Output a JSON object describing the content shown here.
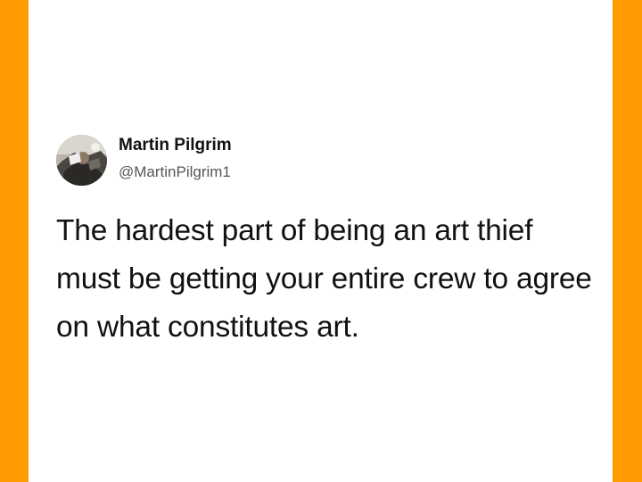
{
  "colors": {
    "background": "#FF9B00",
    "card": "#FFFFFF",
    "text": "#111111",
    "handle": "#565656"
  },
  "tweet": {
    "author": {
      "display_name": "Martin Pilgrim",
      "handle": "@MartinPilgrim1",
      "avatar_icon": "profile-photo"
    },
    "text": "The hardest part of being an art thief must be getting your entire crew to agree on what constitutes art."
  }
}
